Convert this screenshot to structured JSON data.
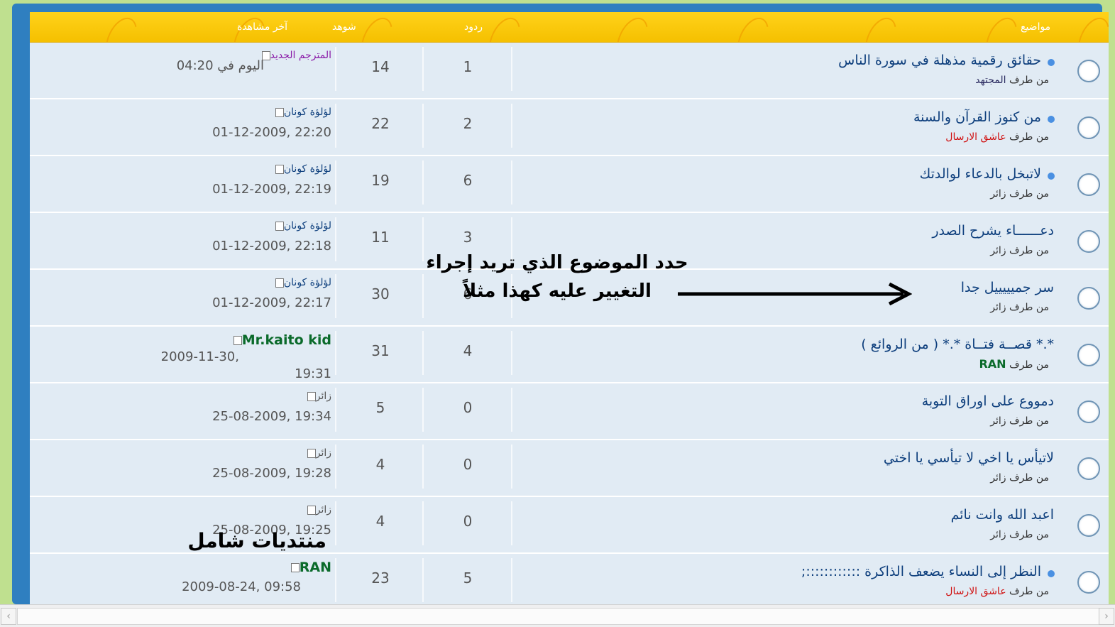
{
  "header": {
    "topics": "مواضيع",
    "replies": "ردود",
    "views": "شوهد",
    "last_post": "آخر مشاهدة"
  },
  "topics": [
    {
      "title": "حقائق رقمية مذهلة في سورة الناس",
      "by_prefix": "من طرف",
      "author": "المجتهد",
      "author_style": "dark",
      "bullet": true,
      "replies": "1",
      "views": "14",
      "last_author": "المترجم الجديد",
      "last_author_style": "purple",
      "last_date": "اليوم في 04:20"
    },
    {
      "title": "من كنوز القرآن والسنة",
      "by_prefix": "من طرف",
      "author": "عاشق الارسال",
      "author_style": "red",
      "bullet": true,
      "replies": "2",
      "views": "22",
      "last_author": "لؤلؤة كونان",
      "last_author_style": "blue",
      "last_date": "01-12-2009, 22:20"
    },
    {
      "title": "لاتبخل بالدعاء لوالدتك",
      "by_prefix": "من طرف",
      "author": "زائر",
      "author_style": "plain",
      "bullet": true,
      "replies": "6",
      "views": "19",
      "last_author": "لؤلؤة كونان",
      "last_author_style": "blue",
      "last_date": "01-12-2009, 22:19"
    },
    {
      "title": "دعــــــاء يشرح الصدر",
      "by_prefix": "من طرف",
      "author": "زائر",
      "author_style": "plain",
      "bullet": false,
      "replies": "3",
      "views": "11",
      "last_author": "لؤلؤة كونان",
      "last_author_style": "blue",
      "last_date": "01-12-2009, 22:18"
    },
    {
      "title": "سر جميييييل جدا",
      "by_prefix": "من طرف",
      "author": "زائر",
      "author_style": "plain",
      "bullet": false,
      "replies": "6",
      "views": "30",
      "last_author": "لؤلؤة كونان",
      "last_author_style": "blue",
      "last_date": "01-12-2009, 22:17"
    },
    {
      "title": "*.* قصــة فتــاة *.* ( من الروائع )",
      "by_prefix": "من طرف",
      "author": "RAN",
      "author_style": "green",
      "bullet": false,
      "replies": "4",
      "views": "31",
      "last_author": "Mr.kaito kid",
      "last_author_style": "green",
      "last_date": "2009-11-30,",
      "last_time": "19:31"
    },
    {
      "title": "دمووع على اوراق التوبة",
      "by_prefix": "من طرف",
      "author": "زائر",
      "author_style": "plain",
      "bullet": false,
      "replies": "0",
      "views": "5",
      "last_author": "زائر",
      "last_author_style": "grey",
      "last_date": "25-08-2009, 19:34"
    },
    {
      "title": "لاتيأس يا اخي لا تيأسي يا اختي",
      "by_prefix": "من طرف",
      "author": "زائر",
      "author_style": "plain",
      "bullet": false,
      "replies": "0",
      "views": "4",
      "last_author": "زائر",
      "last_author_style": "grey",
      "last_date": "25-08-2009, 19:28"
    },
    {
      "title": "اعبد الله وانت نائم",
      "by_prefix": "من طرف",
      "author": "زائر",
      "author_style": "plain",
      "bullet": false,
      "replies": "0",
      "views": "4",
      "last_author": "زائر",
      "last_author_style": "grey",
      "last_date": "25-08-2009, 19:25"
    },
    {
      "title": "النظر إلى النساء يضعف الذاكرة ::::::::::::;",
      "by_prefix": "من طرف",
      "author": "عاشق الارسال",
      "author_style": "red",
      "bullet": true,
      "replies": "5",
      "views": "23",
      "last_author": "RAN",
      "last_author_style": "green",
      "last_date": "2009-08-24, 09:58"
    }
  ],
  "annotation": {
    "line1": "حدد الموضوع الذي تريد إجراء",
    "line2": "التغيير عليه كهذا مثلاً"
  },
  "watermark": "منتديات شامل",
  "icons": {
    "scroll_left": "chevron-left-icon",
    "scroll_right": "chevron-right-icon"
  }
}
